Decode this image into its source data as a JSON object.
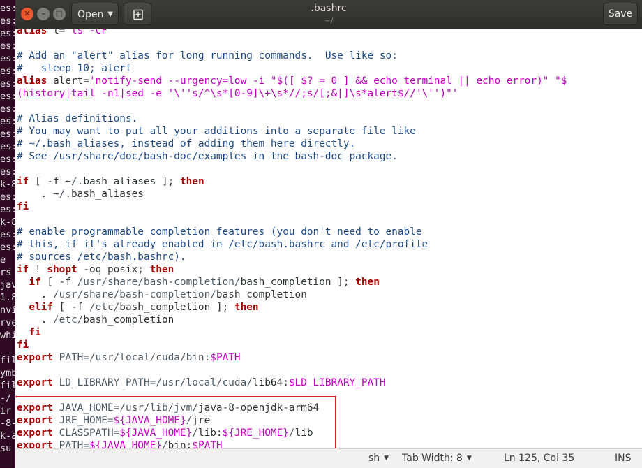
{
  "terminal_fragments": [
    "es:",
    "es:",
    "es:",
    "es:",
    "es:",
    "es:",
    "es:",
    "es:",
    "es:",
    "es:",
    "es:",
    "es:",
    "es:",
    "es:",
    "k-8",
    "es:",
    "es:",
    "k-8",
    "es:",
    "es:",
    "e",
    "rs",
    "jav",
    "1.8",
    "nvi",
    "rve",
    "whi",
    "",
    "fil",
    "ymb",
    "fil",
    "-/",
    "ir",
    "-8-",
    "k-a",
    "su"
  ],
  "window": {
    "title": ".bashrc",
    "subtitle": "~/",
    "open_label": "Open",
    "save_label": "Save"
  },
  "status": {
    "language": "sh",
    "tab_width": "Tab Width: 8",
    "position": "Ln 125, Col 35",
    "mode": "INS"
  },
  "lines": [
    {
      "n": 0,
      "segs": [
        [
          "kw",
          "alias"
        ],
        [
          "plain",
          " l="
        ],
        [
          "str",
          "'ls -CF'"
        ]
      ]
    },
    {
      "n": 1,
      "segs": []
    },
    {
      "n": 2,
      "segs": [
        [
          "comment",
          "# Add an \"alert\" alias for long running commands.  Use like so:"
        ]
      ]
    },
    {
      "n": 3,
      "segs": [
        [
          "comment",
          "#   sleep 10; alert"
        ]
      ]
    },
    {
      "n": 4,
      "segs": [
        [
          "kw",
          "alias"
        ],
        [
          "plain",
          " alert="
        ],
        [
          "str",
          "'notify-send --urgency=low -i \"$([ $? = 0 ] && echo terminal || echo error)\" \"$"
        ]
      ]
    },
    {
      "n": 5,
      "segs": [
        [
          "str",
          "(history|tail -n1|sed -e '\\''s/^\\s*[0-9]\\+\\s*//;s/[;&|]\\s*alert$//'\\'')\"'"
        ]
      ]
    },
    {
      "n": 6,
      "segs": []
    },
    {
      "n": 7,
      "segs": [
        [
          "comment",
          "# Alias definitions."
        ]
      ]
    },
    {
      "n": 8,
      "segs": [
        [
          "comment",
          "# You may want to put all your additions into a separate file like"
        ]
      ]
    },
    {
      "n": 9,
      "segs": [
        [
          "comment",
          "# ~/.bash_aliases, instead of adding them here directly."
        ]
      ]
    },
    {
      "n": 10,
      "segs": [
        [
          "comment",
          "# See /usr/share/doc/bash-doc/examples in the bash-doc package."
        ]
      ]
    },
    {
      "n": 11,
      "segs": []
    },
    {
      "n": 12,
      "segs": [
        [
          "kw",
          "if"
        ],
        [
          "plain",
          " [ -f ~"
        ],
        [
          "path",
          "/"
        ],
        [
          "plain",
          ".bash_aliases ]; "
        ],
        [
          "kw",
          "then"
        ]
      ]
    },
    {
      "n": 13,
      "segs": [
        [
          "plain",
          "    . ~"
        ],
        [
          "path",
          "/"
        ],
        [
          "plain",
          ".bash_aliases"
        ]
      ]
    },
    {
      "n": 14,
      "segs": [
        [
          "kw",
          "fi"
        ]
      ]
    },
    {
      "n": 15,
      "segs": []
    },
    {
      "n": 16,
      "segs": [
        [
          "comment",
          "# enable programmable completion features (you don't need to enable"
        ]
      ]
    },
    {
      "n": 17,
      "segs": [
        [
          "comment",
          "# this, if it's already enabled in /etc/bash.bashrc and /etc/profile"
        ]
      ]
    },
    {
      "n": 18,
      "segs": [
        [
          "comment",
          "# sources /etc/bash.bashrc)."
        ]
      ]
    },
    {
      "n": 19,
      "segs": [
        [
          "kw",
          "if"
        ],
        [
          "plain",
          " ! "
        ],
        [
          "kw",
          "shopt"
        ],
        [
          "plain",
          " -oq posix; "
        ],
        [
          "kw",
          "then"
        ]
      ]
    },
    {
      "n": 20,
      "segs": [
        [
          "plain",
          "  "
        ],
        [
          "kw",
          "if"
        ],
        [
          "plain",
          " [ -f "
        ],
        [
          "path",
          "/usr/share/bash-completion/"
        ],
        [
          "plain",
          "bash_completion ]; "
        ],
        [
          "kw",
          "then"
        ]
      ]
    },
    {
      "n": 21,
      "segs": [
        [
          "plain",
          "    . "
        ],
        [
          "path",
          "/usr/share/bash-completion/"
        ],
        [
          "plain",
          "bash_completion"
        ]
      ]
    },
    {
      "n": 22,
      "segs": [
        [
          "plain",
          "  "
        ],
        [
          "kw",
          "elif"
        ],
        [
          "plain",
          " [ -f "
        ],
        [
          "path",
          "/etc/"
        ],
        [
          "plain",
          "bash_completion ]; "
        ],
        [
          "kw",
          "then"
        ]
      ]
    },
    {
      "n": 23,
      "segs": [
        [
          "plain",
          "    . "
        ],
        [
          "path",
          "/etc/"
        ],
        [
          "plain",
          "bash_completion"
        ]
      ]
    },
    {
      "n": 24,
      "segs": [
        [
          "plain",
          "  "
        ],
        [
          "kw",
          "fi"
        ]
      ]
    },
    {
      "n": 25,
      "segs": [
        [
          "kw",
          "fi"
        ]
      ]
    },
    {
      "n": 26,
      "segs": [
        [
          "kw",
          "export"
        ],
        [
          "plain",
          " "
        ],
        [
          "path",
          "PATH="
        ],
        [
          "path",
          "/usr/local/cuda/bin"
        ],
        [
          "plain",
          ":"
        ],
        [
          "var",
          "$PATH"
        ]
      ]
    },
    {
      "n": 27,
      "segs": []
    },
    {
      "n": 28,
      "segs": [
        [
          "kw",
          "export"
        ],
        [
          "plain",
          " "
        ],
        [
          "path",
          "LD_LIBRARY_PATH="
        ],
        [
          "path",
          "/usr/local/cuda/"
        ],
        [
          "plain",
          "lib64:"
        ],
        [
          "var",
          "$LD_LIBRARY_PATH"
        ]
      ]
    },
    {
      "n": 29,
      "segs": []
    },
    {
      "n": 30,
      "segs": [
        [
          "kw",
          "export"
        ],
        [
          "plain",
          " "
        ],
        [
          "path",
          "JAVA_HOME="
        ],
        [
          "path",
          "/usr/lib/jvm/"
        ],
        [
          "plain",
          "java-8-openjdk-arm64"
        ]
      ]
    },
    {
      "n": 31,
      "segs": [
        [
          "kw",
          "export"
        ],
        [
          "plain",
          " "
        ],
        [
          "path",
          "JRE_HOME="
        ],
        [
          "var",
          "${JAVA_HOME}"
        ],
        [
          "path",
          "/"
        ],
        [
          "plain",
          "jre"
        ]
      ]
    },
    {
      "n": 32,
      "segs": [
        [
          "kw",
          "export"
        ],
        [
          "plain",
          " "
        ],
        [
          "path",
          "CLASSPATH="
        ],
        [
          "var",
          "${JAVA_HOME}"
        ],
        [
          "path",
          "/"
        ],
        [
          "plain",
          "lib:"
        ],
        [
          "var",
          "${JRE_HOME}"
        ],
        [
          "path",
          "/"
        ],
        [
          "plain",
          "lib"
        ]
      ]
    },
    {
      "n": 33,
      "segs": [
        [
          "kw",
          "export"
        ],
        [
          "plain",
          " "
        ],
        [
          "path",
          "PATH="
        ],
        [
          "var",
          "${JAVA_HOME}"
        ],
        [
          "path",
          "/"
        ],
        [
          "plain",
          "bin:"
        ],
        [
          "var",
          "$PATH"
        ]
      ]
    }
  ]
}
